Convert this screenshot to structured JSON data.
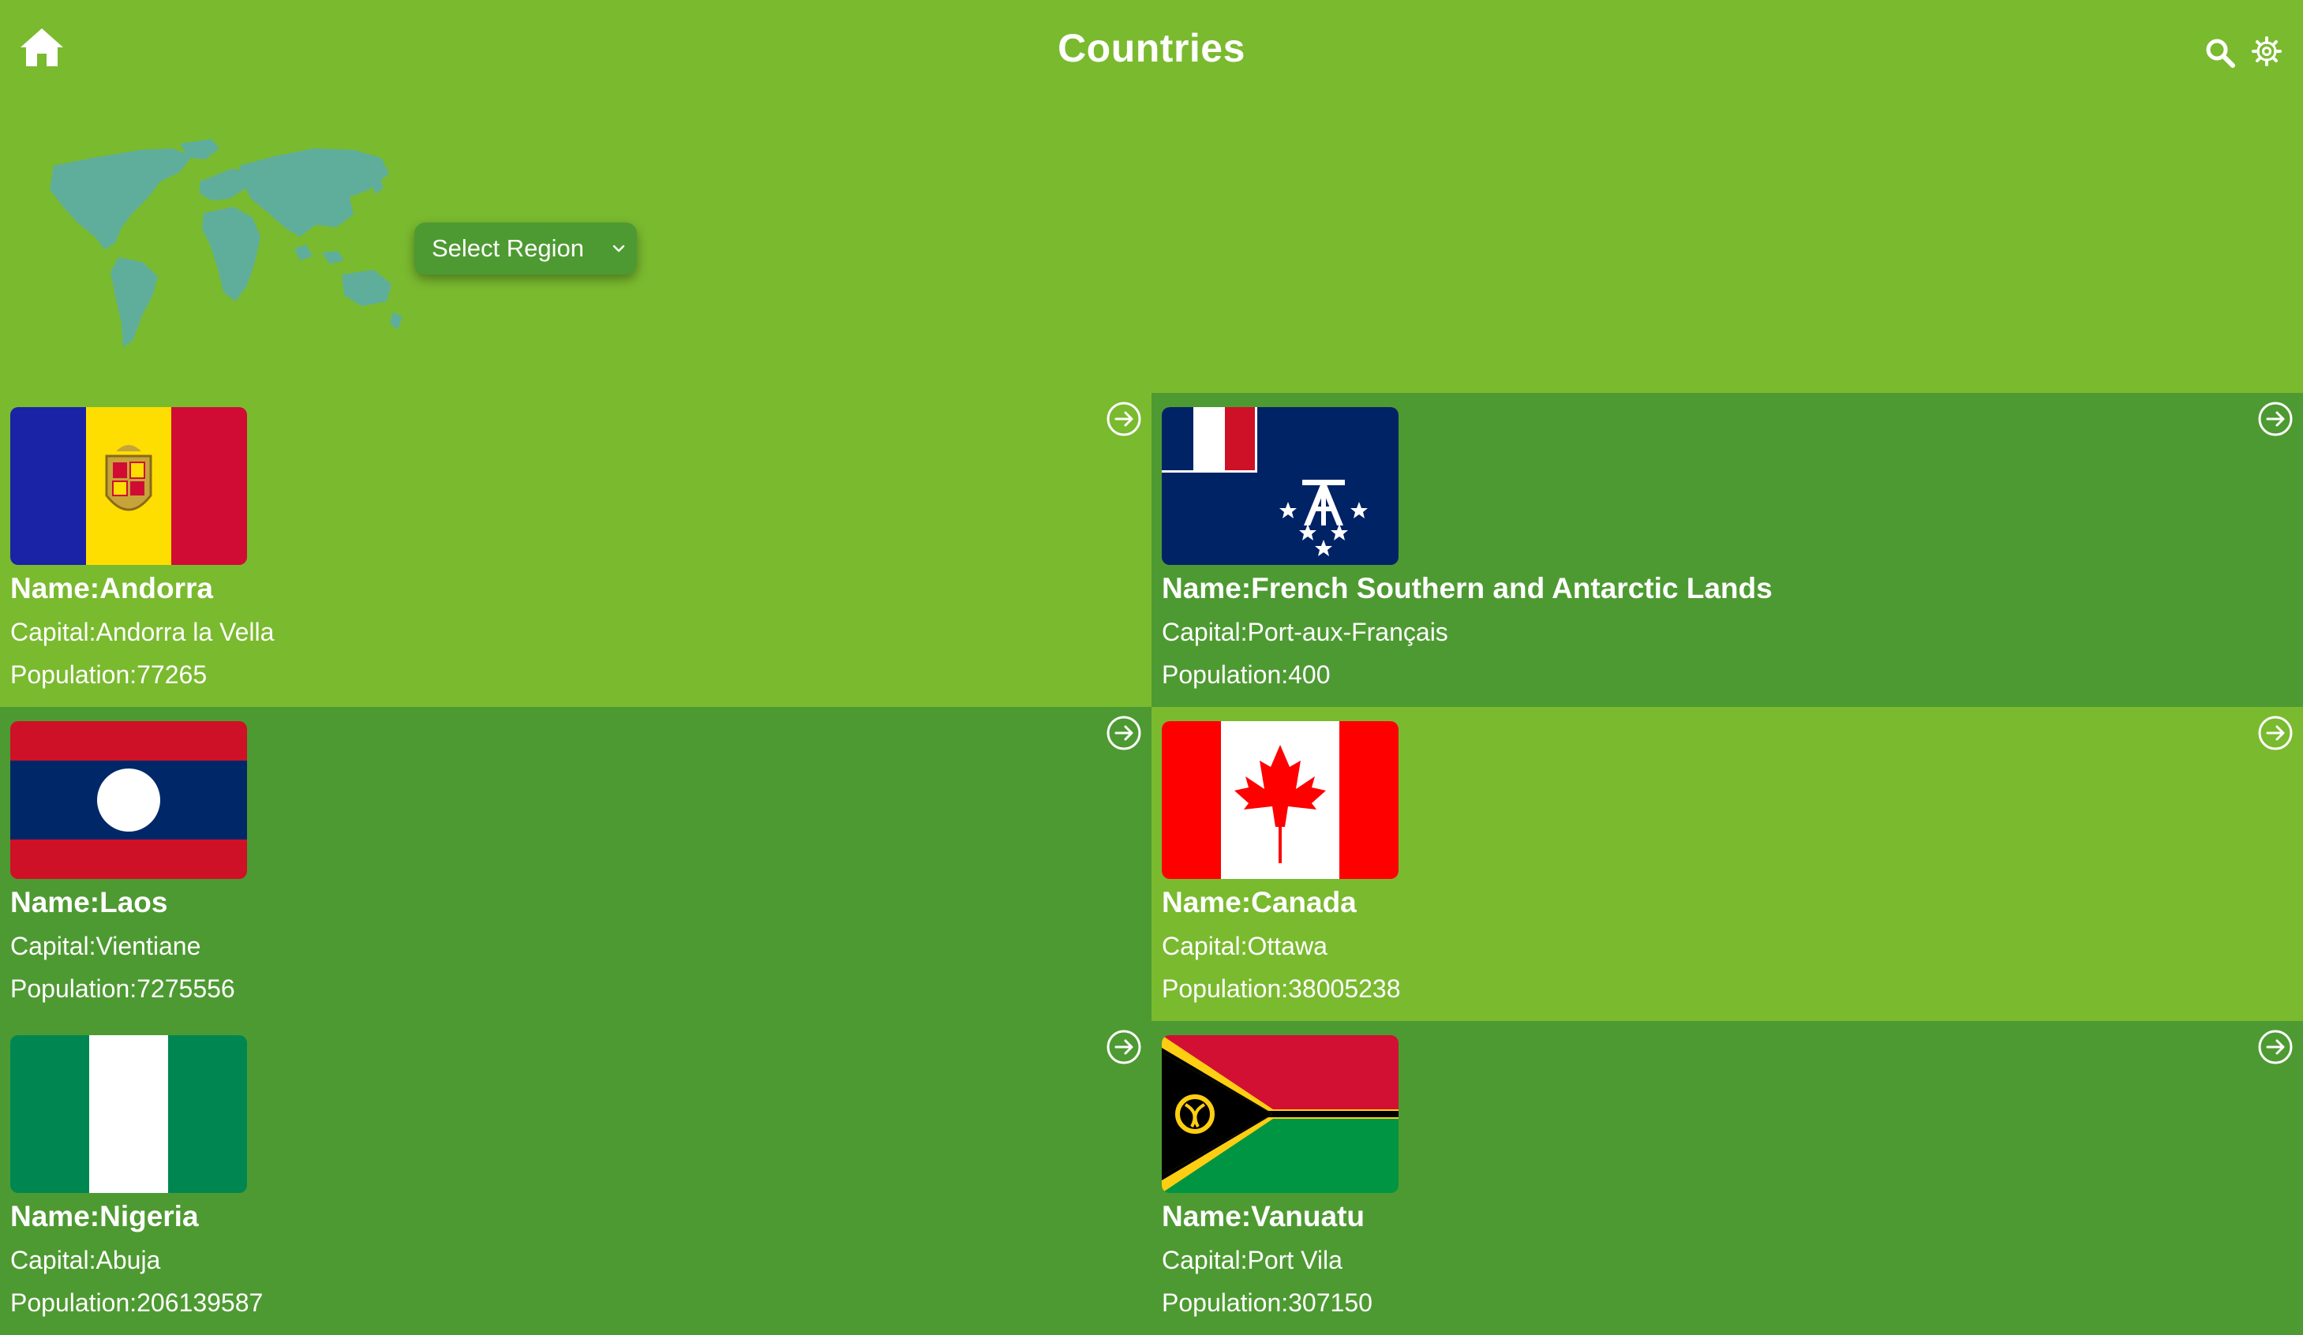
{
  "header": {
    "title": "Countries",
    "home_icon": "home-icon",
    "search_icon": "search-icon",
    "settings_icon": "gear-icon"
  },
  "filter": {
    "region_select": "Select Region",
    "map_icon": "world-map-icon"
  },
  "colors": {
    "background": "#7aba2f",
    "card_dark": "#4e9a32",
    "map": "#5fae9c",
    "text": "#ffffff"
  },
  "countries": [
    {
      "name": "Name:Andorra",
      "capital": "Capital:Andorra la Vella",
      "population": "Population:77265",
      "flag_icon": "andorra-flag-icon"
    },
    {
      "name": "Name:French Southern and Antarctic Lands",
      "capital": "Capital:Port-aux-Français",
      "population": "Population:400",
      "flag_icon": "french-southern-lands-flag-icon"
    },
    {
      "name": "Name:Laos",
      "capital": "Capital:Vientiane",
      "population": "Population:7275556",
      "flag_icon": "laos-flag-icon"
    },
    {
      "name": "Name:Canada",
      "capital": "Capital:Ottawa",
      "population": "Population:38005238",
      "flag_icon": "canada-flag-icon"
    },
    {
      "name": "Name:Nigeria",
      "capital": "Capital:Abuja",
      "population": "Population:206139587",
      "flag_icon": "nigeria-flag-icon"
    },
    {
      "name": "Name:Vanuatu",
      "capital": "Capital:Port Vila",
      "population": "Population:307150",
      "flag_icon": "vanuatu-flag-icon"
    }
  ]
}
